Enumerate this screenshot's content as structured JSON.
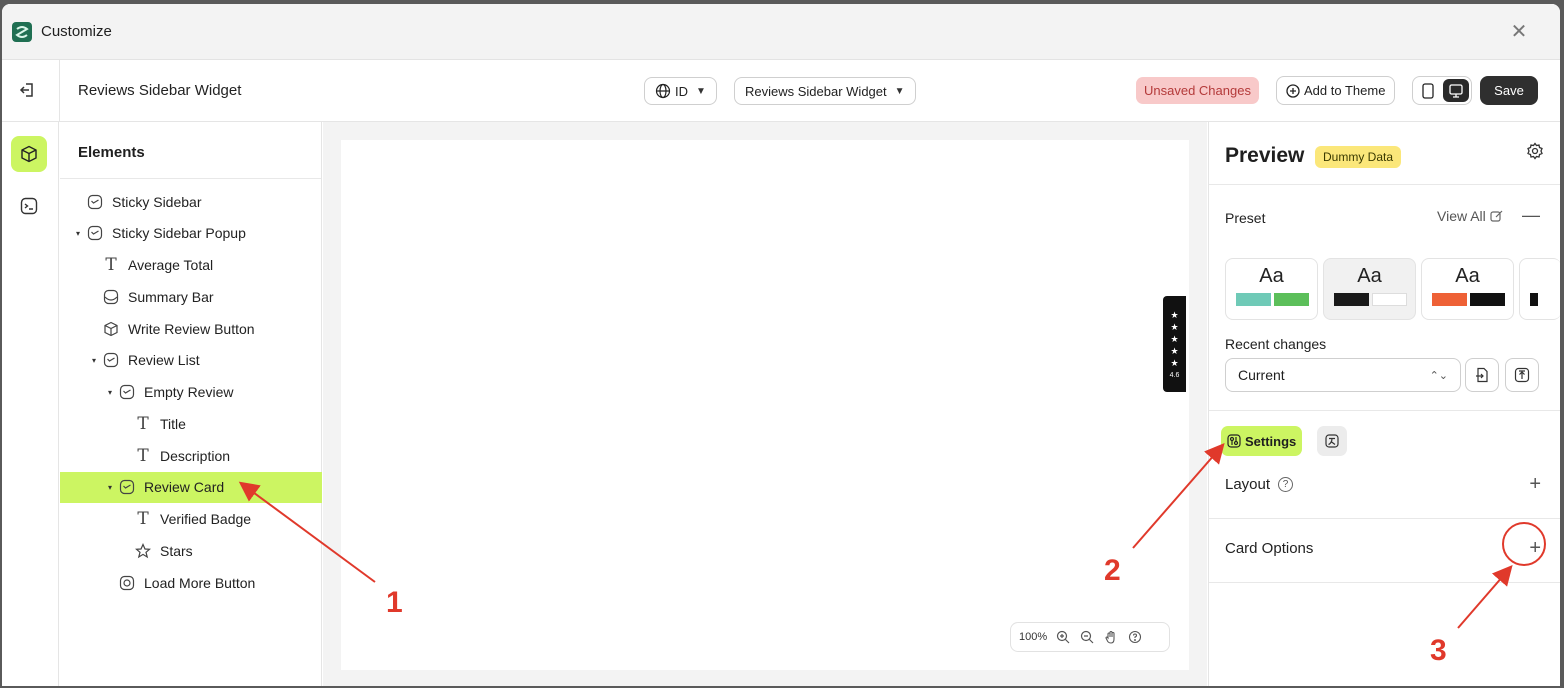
{
  "app": {
    "title": "Customize",
    "logo": "app-logo-icon"
  },
  "toolbar": {
    "widget_name": "Reviews Sidebar Widget",
    "language": "ID",
    "widget_select": "Reviews Sidebar Widget",
    "unsaved": "Unsaved Changes",
    "add_to_theme": "Add to Theme",
    "save": "Save"
  },
  "elements": {
    "title": "Elements",
    "items": [
      {
        "label": "Sticky Sidebar",
        "icon": "block-icon",
        "depth": 0,
        "caret": false
      },
      {
        "label": "Sticky Sidebar Popup",
        "icon": "block-icon",
        "depth": 0,
        "caret": true
      },
      {
        "label": "Average Total",
        "icon": "text-icon",
        "depth": 1,
        "caret": false
      },
      {
        "label": "Summary Bar",
        "icon": "summary-icon",
        "depth": 1,
        "caret": false
      },
      {
        "label": "Write Review Button",
        "icon": "cube-icon",
        "depth": 1,
        "caret": false
      },
      {
        "label": "Review List",
        "icon": "block-icon",
        "depth": 1,
        "caret": true
      },
      {
        "label": "Empty Review",
        "icon": "block-icon",
        "depth": 2,
        "caret": true
      },
      {
        "label": "Title",
        "icon": "text-icon",
        "depth": 3,
        "caret": false
      },
      {
        "label": "Description",
        "icon": "text-icon",
        "depth": 3,
        "caret": false
      },
      {
        "label": "Review Card",
        "icon": "block-icon",
        "depth": 2,
        "caret": true,
        "selected": true
      },
      {
        "label": "Verified Badge",
        "icon": "text-icon",
        "depth": 3,
        "caret": false
      },
      {
        "label": "Stars",
        "icon": "star-icon",
        "depth": 3,
        "caret": false
      },
      {
        "label": "Load More Button",
        "icon": "button-icon",
        "depth": 2,
        "caret": false
      }
    ]
  },
  "canvas": {
    "sticky_rating": "4.6",
    "zoom": "100%"
  },
  "preview": {
    "title": "Preview",
    "badge": "Dummy Data",
    "preset_label": "Preset",
    "view_all": "View All",
    "presets": [
      {
        "label": "Aa",
        "colors": [
          "#6fcab7",
          "#5cbf5a"
        ]
      },
      {
        "label": "Aa",
        "colors": [
          "#1a1a1a",
          "#ffffff"
        ]
      },
      {
        "label": "Aa",
        "colors": [
          "#ee6136",
          "#111111"
        ]
      }
    ],
    "recent_label": "Recent changes",
    "recent_value": "Current",
    "settings_tab": "Settings",
    "sections": [
      {
        "label": "Layout",
        "help": true
      },
      {
        "label": "Card Options",
        "help": false
      }
    ]
  },
  "annotations": [
    "1",
    "2",
    "3"
  ],
  "colors": {
    "accent": "#ccf562",
    "annotation": "#e0392b",
    "badge": "#fbe77a",
    "unsaved_bg": "#f8c9c9"
  }
}
